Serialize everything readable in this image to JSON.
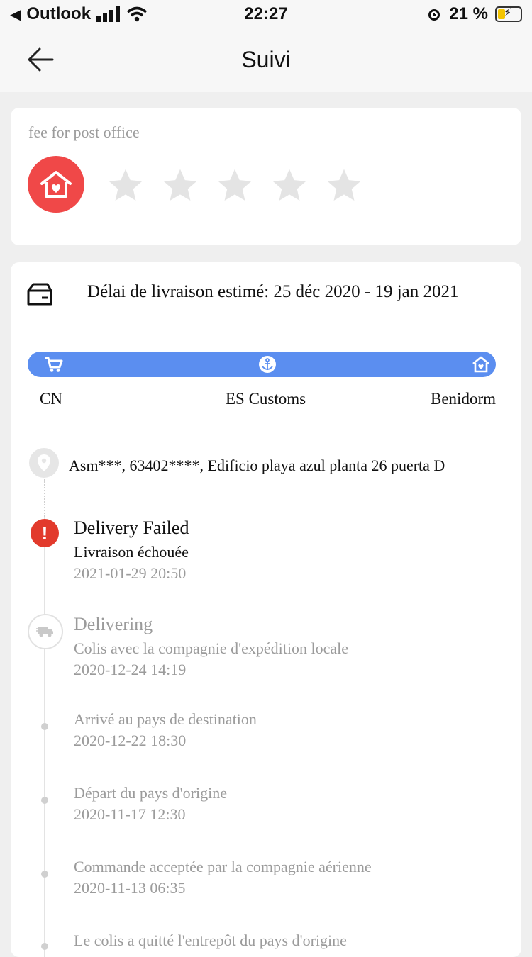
{
  "status_bar": {
    "carrier": "Outlook",
    "time": "22:27",
    "battery": "21 %",
    "battery_level": 0.21
  },
  "nav": {
    "title": "Suivi",
    "back_icon": "arrow-left-icon"
  },
  "rating": {
    "label": "fee for post office",
    "icon": "house-heart-icon",
    "stars_filled": 0,
    "stars_total": 5
  },
  "delivery": {
    "estimate": "Délai de livraison estimé: 25 déc 2020 - 19 jan 2021",
    "progress": {
      "stages": [
        "CN",
        "ES Customs",
        "Benidorm"
      ],
      "icons": [
        "cart-icon",
        "anchor-icon",
        "house-heart-icon"
      ],
      "color": "#5b8ef0"
    },
    "address": "Asm***,  63402****,  Edificio playa azul planta 26 puerta D",
    "events": [
      {
        "title": "Delivery Failed",
        "subtitle": "Livraison échouée",
        "date": "2021-01-29 20:50",
        "icon": "alert-icon",
        "color": "#e23a2c"
      },
      {
        "title": "Delivering",
        "subtitle": "Colis avec la compagnie d'expédition locale",
        "date": "2020-12-24 14:19",
        "icon": "truck-icon"
      },
      {
        "subtitle": "Arrivé au pays de destination",
        "date": "2020-12-22 18:30"
      },
      {
        "subtitle": "Départ du pays d'origine",
        "date": "2020-11-17 12:30"
      },
      {
        "subtitle": "Commande acceptée par la compagnie aérienne",
        "date": "2020-11-13 06:35"
      },
      {
        "subtitle": "Le colis a quitté l'entrepôt du pays d'origine"
      }
    ]
  }
}
